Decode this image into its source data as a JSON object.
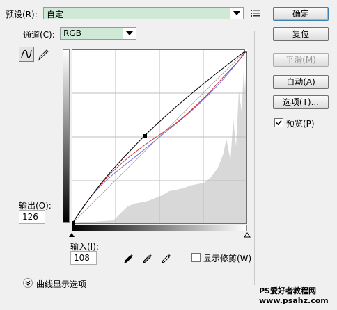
{
  "preset": {
    "label": "预设(R):",
    "value": "自定"
  },
  "buttons": {
    "ok": "确定",
    "reset": "复位",
    "smooth": "平滑(M)",
    "auto": "自动(A)",
    "options": "选项(T)...",
    "preview": "预览(P)"
  },
  "channel": {
    "label": "通道(C):",
    "value": "RGB"
  },
  "output": {
    "label": "输出(O):",
    "value": "126"
  },
  "input": {
    "label": "输入(I):",
    "value": "108"
  },
  "show_clipping": "显示修剪(W)",
  "curve_display_options": "曲线显示选项",
  "watermark": "PS爱好者教程网\nwww.psahz.com",
  "state": {
    "preview_checked": true,
    "show_clipping_checked": false,
    "options_expanded": false
  },
  "colors": {
    "combo_bg": "#cfe9d6",
    "curve": "#000000",
    "red_curve": "#cc2a2a",
    "blue_curve": "#6a6ad8",
    "histogram": "#d8d8d8"
  },
  "icons": [
    "preset-menu-icon",
    "curve-tool-icon",
    "pencil-tool-icon",
    "black-point-eyedropper-icon",
    "gray-point-eyedropper-icon",
    "white-point-eyedropper-icon",
    "expand-chevron-icon"
  ]
}
